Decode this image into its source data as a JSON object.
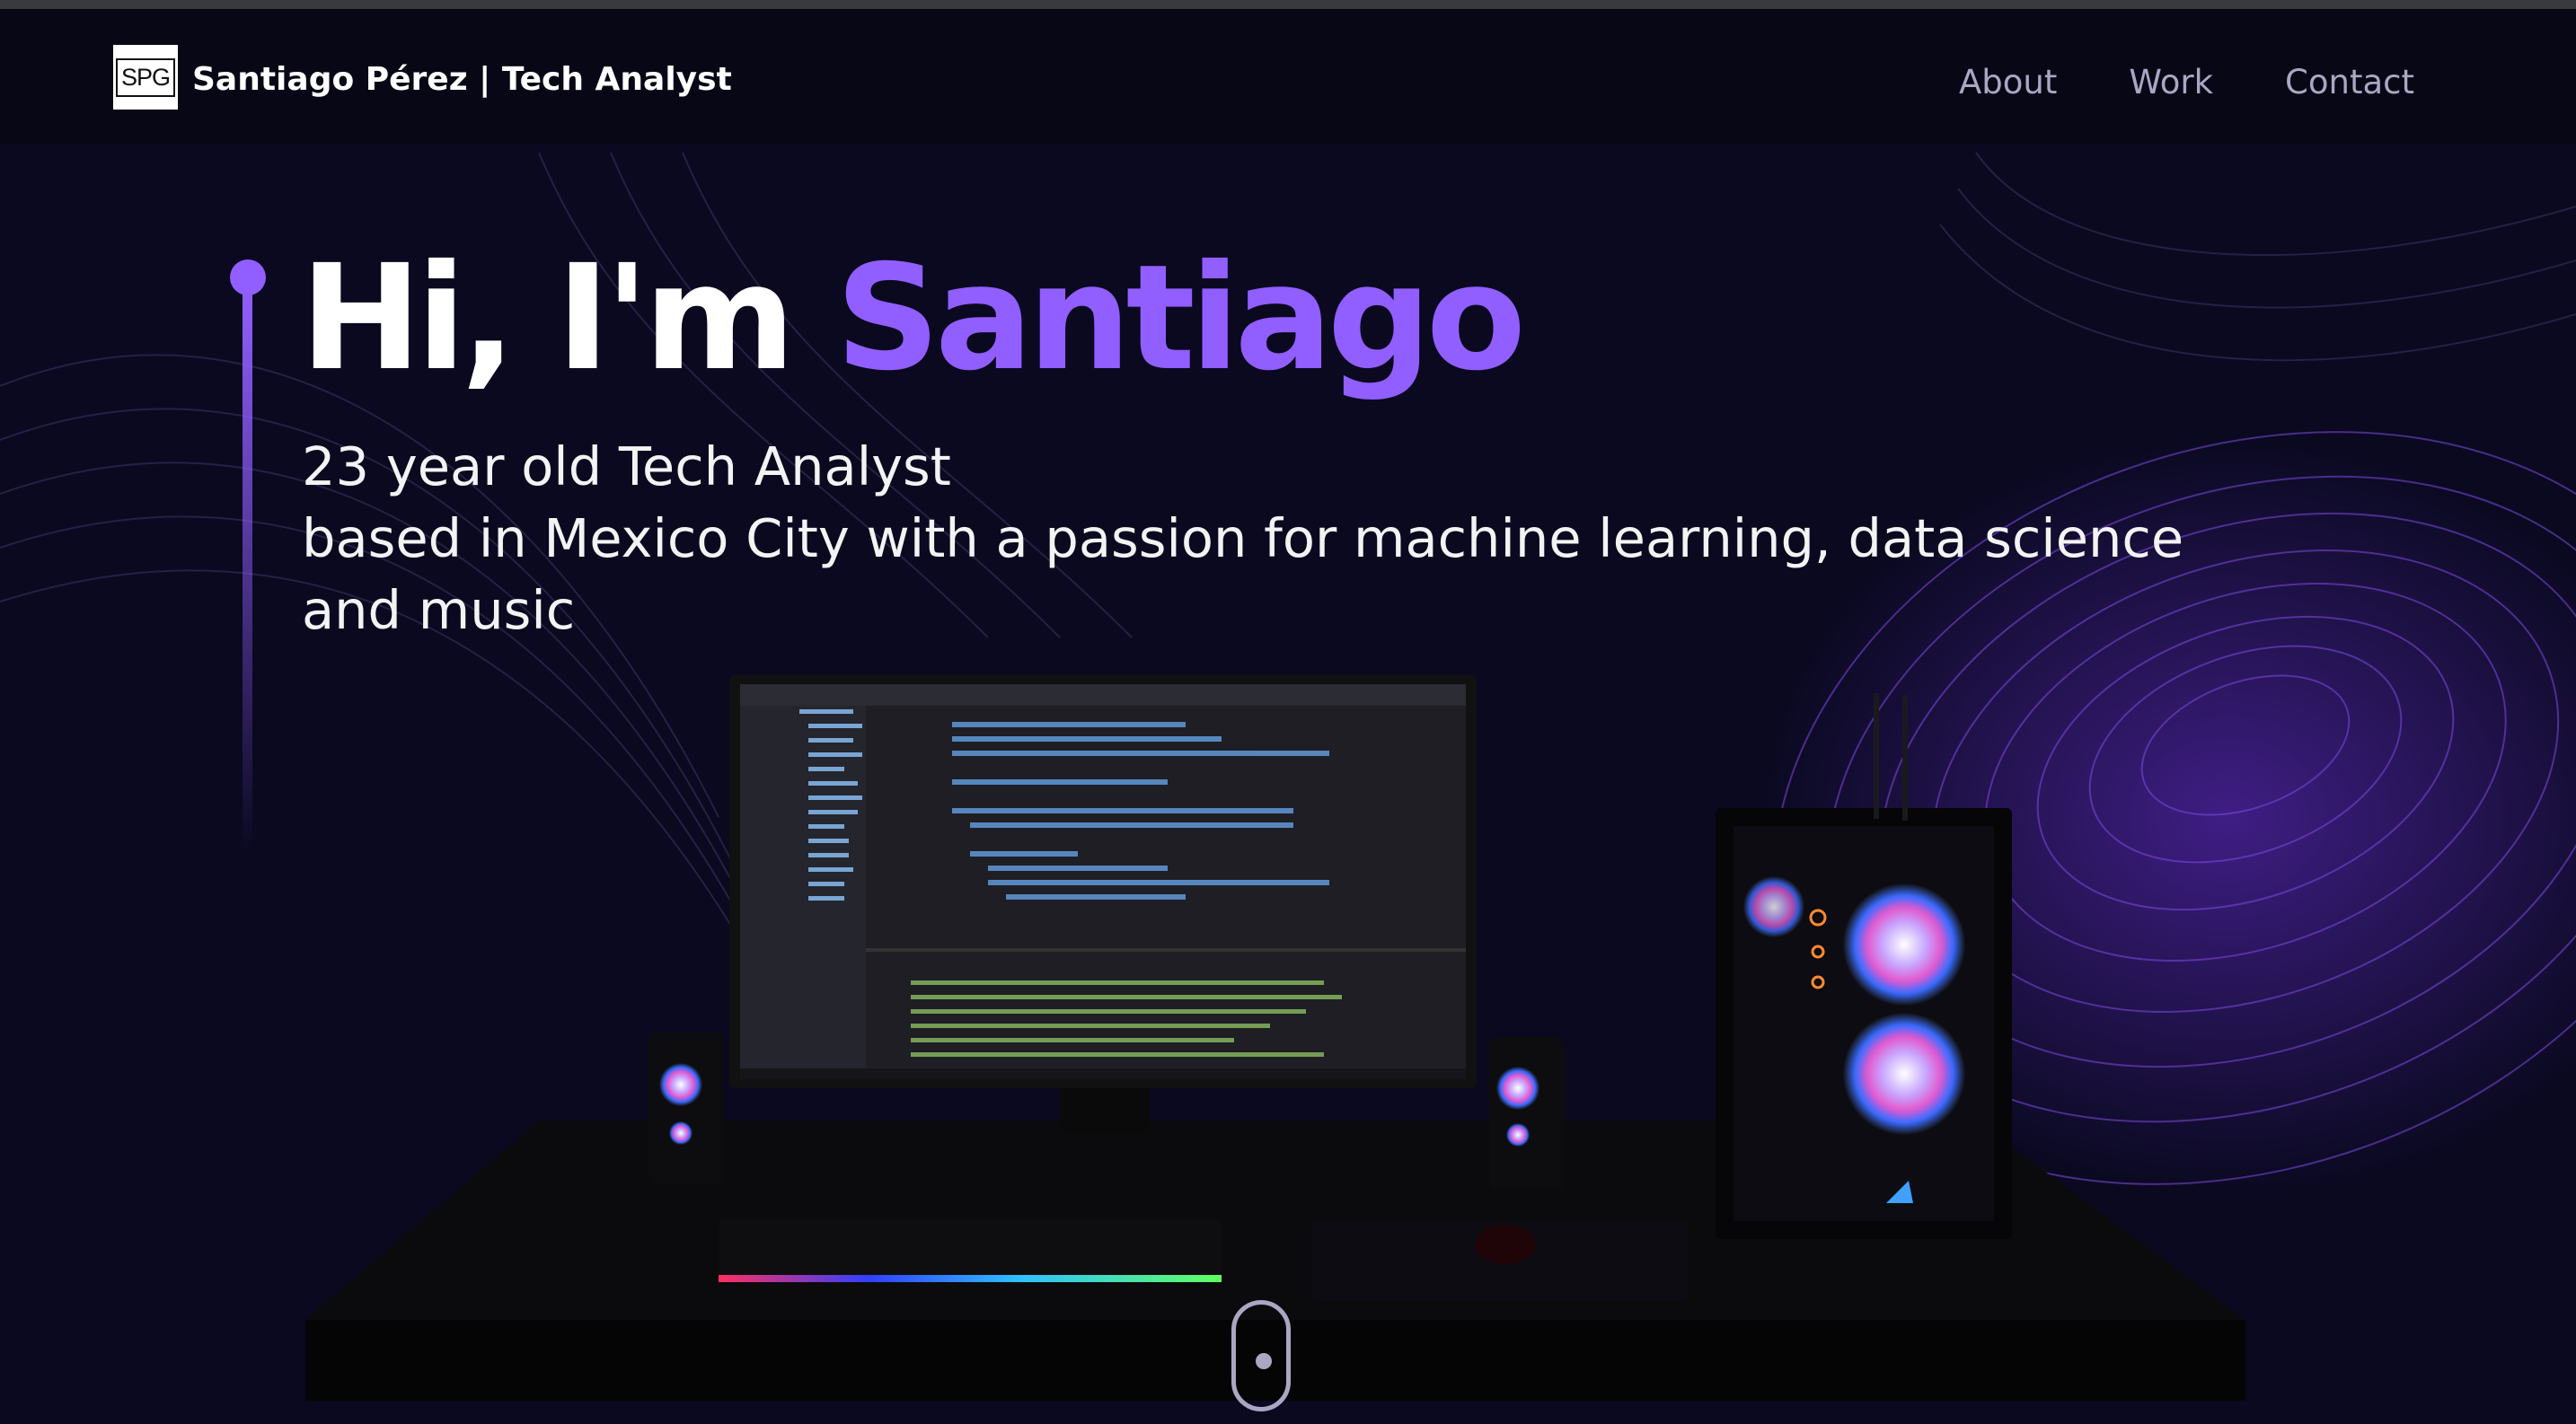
{
  "nav": {
    "logo_text": "SPG",
    "brand": "Santiago Pérez | Tech Analyst",
    "links": [
      "About",
      "Work",
      "Contact"
    ]
  },
  "hero": {
    "greeting": "Hi, I'm",
    "name": "Santiago",
    "subtitle_line1": "23 year old Tech Analyst",
    "subtitle_line2": "based in Mexico City with a passion for machine learning, data science and music"
  },
  "colors": {
    "background": "#070614",
    "accent": "#915eff",
    "nav_link": "#aaa6c3",
    "text": "#ffffff"
  },
  "icons": {
    "scroll": "mouse-scroll-icon"
  }
}
